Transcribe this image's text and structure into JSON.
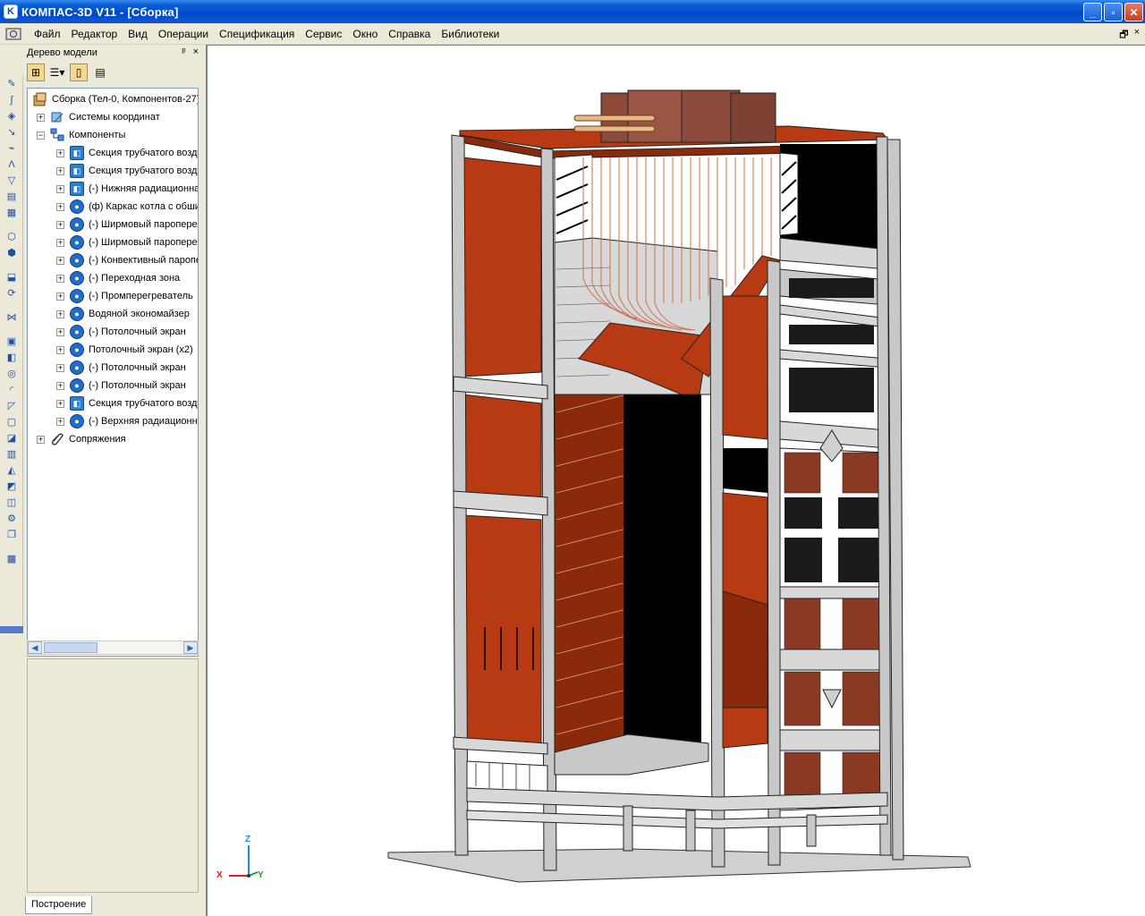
{
  "window": {
    "title": "КОМПАС-3D V11 - [Сборка]",
    "app_icon_letter": "K",
    "buttons": {
      "minimize": "_",
      "maximize": "▫",
      "close": "✕"
    }
  },
  "menu": {
    "items": [
      {
        "label": "Файл"
      },
      {
        "label": "Редактор"
      },
      {
        "label": "Вид"
      },
      {
        "label": "Операции"
      },
      {
        "label": "Спецификация"
      },
      {
        "label": "Сервис"
      },
      {
        "label": "Окно"
      },
      {
        "label": "Справка"
      },
      {
        "label": "Библиотеки"
      }
    ],
    "mdi": {
      "restore": "🗗",
      "close": "×"
    }
  },
  "tree_panel": {
    "title": "Дерево модели",
    "pin": "ᵖ",
    "close": "×",
    "root": "Сборка (Тел-0, Компонентов-27)",
    "coordinate_systems": "Системы координат",
    "components_label": "Компоненты",
    "components": [
      "Секция трубчатого воздухоподогревателя",
      "Секция трубчатого воздухоподогревателя",
      "(-) Нижняя радиационная часть",
      "(ф) Каркас котла с обшивкой",
      "(-) Ширмовый пароперегреватель",
      "(-) Ширмовый пароперегреватель",
      "(-) Конвективный пароперегреватель",
      "(-) Переходная зона",
      "(-) Промперегреватель",
      "Водяной экономайзер",
      "(-) Потолочный экран",
      "Потолочный экран (x2)",
      "(-) Потолочный экран",
      "(-) Потолочный экран",
      "Секция трубчатого воздухоподогревателя",
      "(-) Верхняя радиационная часть"
    ],
    "mates": "Сопряжения",
    "tab": "Построение"
  },
  "axes": {
    "x": "X",
    "y": "Y",
    "z": "Z"
  },
  "colors": {
    "titlebar": "#0a56d6",
    "boiler_red": "#b83a12",
    "steel_grey": "#c8c8c8"
  }
}
